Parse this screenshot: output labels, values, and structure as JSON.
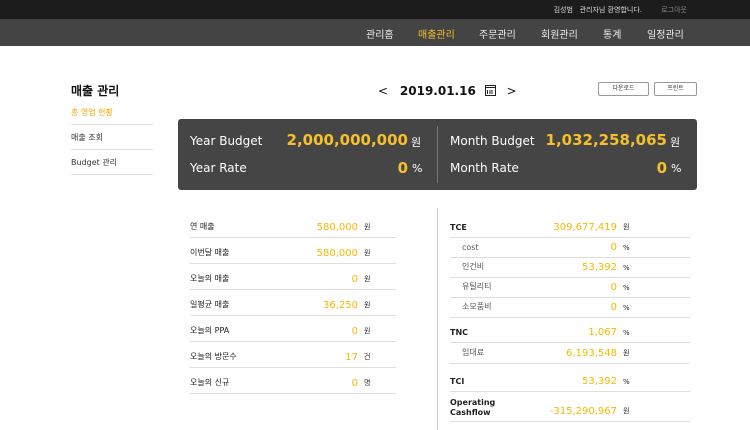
{
  "topbar": {
    "user_name": "김성범",
    "welcome": "관리자님 환영합니다.",
    "logout": "로그아웃"
  },
  "nav": [
    "관리홈",
    "매출관리",
    "주문관리",
    "회원관리",
    "통계",
    "일정관리"
  ],
  "nav_active": "매출관리",
  "sidebar": {
    "title": "매출 관리",
    "items": [
      {
        "label": "총 영업 현황"
      },
      {
        "label": "매출 조회"
      },
      {
        "label": "Budget 관리"
      }
    ]
  },
  "date_nav": {
    "prev": "<",
    "date": "2019.01.16",
    "next": ">"
  },
  "buttons": {
    "download": "다운로드",
    "print": "프린트"
  },
  "summary": {
    "year_budget": {
      "label": "Year Budget",
      "value": "2,000,000,000",
      "unit": "원"
    },
    "month_budget": {
      "label": "Month Budget",
      "value": "1,032,258,065",
      "unit": "원"
    },
    "year_rate": {
      "label": "Year Rate",
      "value": "0",
      "unit": "%"
    },
    "month_rate": {
      "label": "Month Rate",
      "value": "0",
      "unit": "%"
    }
  },
  "left_stats": [
    {
      "label": "연 매출",
      "value": "580,000",
      "unit": "원",
      "bold": false
    },
    {
      "label": "이번달 매출",
      "value": "580,000",
      "unit": "원",
      "bold": false
    },
    {
      "label": "오늘의 매출",
      "value": "0",
      "unit": "원",
      "bold": false
    },
    {
      "label": "일평균 매출",
      "value": "36,250",
      "unit": "원",
      "bold": false
    },
    {
      "label": "오늘의 PPA",
      "value": "0",
      "unit": "원",
      "bold": false
    },
    {
      "label": "오늘의 방문수",
      "value": "17",
      "unit": "건",
      "bold": false
    },
    {
      "label": "오늘의 신규",
      "value": "0",
      "unit": "명",
      "bold": false
    }
  ],
  "right_stats": [
    {
      "label": "TCE",
      "value": "309,677,419",
      "unit": "원",
      "bold": true,
      "sub": false
    },
    {
      "label": "cost",
      "value": "0",
      "unit": "%",
      "bold": false,
      "sub": true
    },
    {
      "label": "인건비",
      "value": "53,392",
      "unit": "%",
      "bold": false,
      "sub": true
    },
    {
      "label": "유틸리티",
      "value": "0",
      "unit": "%",
      "bold": false,
      "sub": true
    },
    {
      "label": "소모품비",
      "value": "0",
      "unit": "%",
      "bold": false,
      "sub": true
    },
    {
      "label": "TNC",
      "value": "1,067",
      "unit": "%",
      "bold": true,
      "sub": false
    },
    {
      "label": "임대료",
      "value": "6,193,548",
      "unit": "원",
      "bold": false,
      "sub": true
    },
    {
      "label": "TCI",
      "value": "53,392",
      "unit": "%",
      "bold": true,
      "sub": false
    },
    {
      "label": "Operating\nCashflow",
      "value": "-315,290,967",
      "unit": "원",
      "bold": true,
      "sub": false
    }
  ],
  "colors": {
    "accent": "#f5c02b",
    "topbar": "#1c1c1c",
    "navbar": "#444444",
    "panel": "#454545"
  }
}
